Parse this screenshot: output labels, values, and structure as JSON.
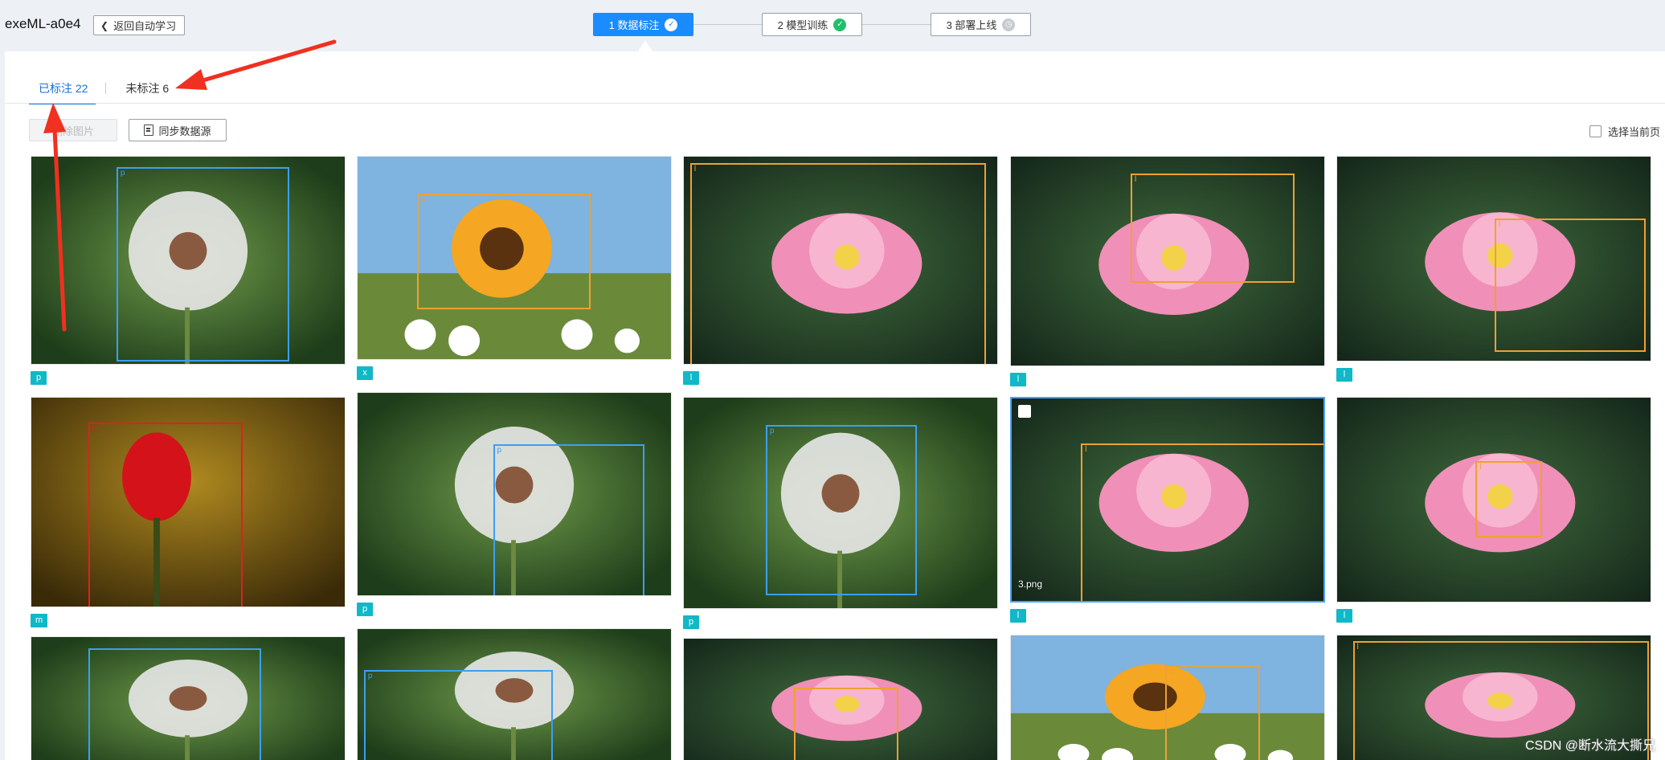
{
  "header": {
    "app_title": "exeML-a0e4",
    "back_label": "返回自动学习",
    "steps": [
      {
        "label": "1 数据标注",
        "state": "active"
      },
      {
        "label": "2 模型训练",
        "state": "done"
      },
      {
        "label": "3 部署上线",
        "state": "pending"
      }
    ]
  },
  "tabs": [
    {
      "label": "已标注 22",
      "active": true
    },
    {
      "label": "未标注 6",
      "active": false
    }
  ],
  "toolbar": {
    "delete_label": "删除图片",
    "sync_label": "同步数据源",
    "select_page_label": "选择当前页"
  },
  "colors": {
    "accent": "#1a8cff",
    "tag": "#11b8c7",
    "bbox_blue": "#3a9ff5",
    "bbox_orange": "#f0a030",
    "bbox_red": "#e02020",
    "arrow": "#f03020"
  },
  "images": [
    {
      "tag": "p",
      "subject": "dandelion",
      "box_label": "p"
    },
    {
      "tag": "x",
      "subject": "sunflower",
      "box_label": "x"
    },
    {
      "tag": "l",
      "subject": "lotus",
      "box_label": "l"
    },
    {
      "tag": "l",
      "subject": "lotus",
      "box_label": "l"
    },
    {
      "tag": "l",
      "subject": "lotus",
      "box_label": "l"
    },
    {
      "tag": "m",
      "subject": "rose",
      "box_label": "m"
    },
    {
      "tag": "p",
      "subject": "dandelion",
      "box_label": "p"
    },
    {
      "tag": "p",
      "subject": "dandelion",
      "box_label": "p"
    },
    {
      "tag": "l",
      "subject": "lotus",
      "box_label": "l",
      "filename": "3.png",
      "selected": true
    },
    {
      "tag": "l",
      "subject": "lotus",
      "box_label": "l"
    },
    {
      "tag": "",
      "subject": "dandelion",
      "box_label": ""
    },
    {
      "tag": "",
      "subject": "dandelion",
      "box_label": "p"
    },
    {
      "tag": "",
      "subject": "lotus",
      "box_label": ""
    },
    {
      "tag": "",
      "subject": "sunflower",
      "box_label": "x"
    },
    {
      "tag": "",
      "subject": "lotus",
      "box_label": "l"
    }
  ],
  "watermark": "CSDN @断水流大撕兄"
}
